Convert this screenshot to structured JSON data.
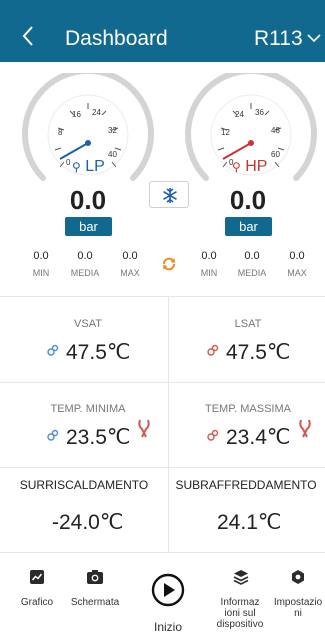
{
  "header": {
    "title": "Dashboard",
    "refrigerant": "R113"
  },
  "gauges": {
    "lp": {
      "label": "LP",
      "ticks": [
        "0",
        "8",
        "16",
        "24",
        "32",
        "40"
      ],
      "value": "0.0",
      "unit": "bar"
    },
    "hp": {
      "label": "HP",
      "ticks": [
        "0",
        "12",
        "24",
        "36",
        "48",
        "60"
      ],
      "value": "0.0",
      "unit": "bar"
    }
  },
  "stats": {
    "lp": {
      "min": "0.0",
      "media": "0.0",
      "max": "0.0"
    },
    "hp": {
      "min": "0.0",
      "media": "0.0",
      "max": "0.0"
    },
    "labels": {
      "min": "MIN",
      "media": "MEDIA",
      "max": "MAX"
    }
  },
  "readings": {
    "vsat": {
      "label": "VSAT",
      "value": "47.5℃"
    },
    "lsat": {
      "label": "LSAT",
      "value": "47.5℃"
    },
    "temp_min": {
      "label": "TEMP. MINIMA",
      "value": "23.5℃"
    },
    "temp_max": {
      "label": "TEMP. MASSIMA",
      "value": "23.4℃"
    },
    "surriscaldamento": {
      "label": "SURRISCALDAMENTO",
      "value": "-24.0℃"
    },
    "subraffreddamento": {
      "label": "SUBRAFFREDDAMENTO",
      "value": "24.1℃"
    }
  },
  "tabs": {
    "grafico": "Grafico",
    "schermata": "Schermata",
    "inizio": "Inizio",
    "info_line1": "Informaz",
    "info_line2": "ioni sul",
    "info_line3": "dispositivo",
    "impost_line1": "Impostazio",
    "impost_line2": "ni"
  },
  "colors": {
    "header": "#12698f",
    "lp_accent": "#1d5fb0",
    "hp_accent": "#c8362f",
    "refresh": "#f08a24"
  }
}
